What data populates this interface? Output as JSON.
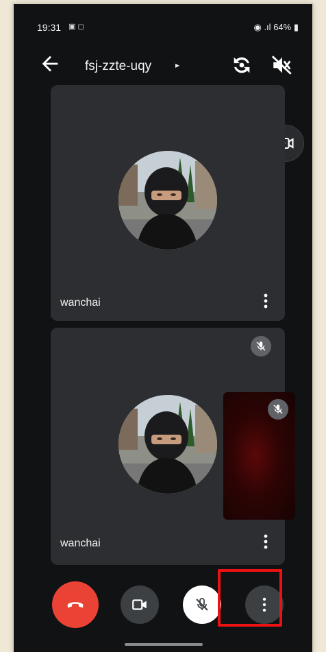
{
  "status_bar": {
    "time": "19:31",
    "left_icons": "▣ ◻",
    "right_text": "64%",
    "right_signal": "◉ .ıl"
  },
  "top_bar": {
    "meeting_code": "fsj-zzte-uqy",
    "caret": "▸",
    "icons": [
      "back-arrow-icon",
      "rotate-camera-icon",
      "speaker-off-icon"
    ]
  },
  "participants": [
    {
      "name": "wanchai",
      "muted": false
    },
    {
      "name": "wanchai",
      "muted": true
    }
  ],
  "self_view": {
    "muted": true,
    "background_color": "#5a0808"
  },
  "controls": {
    "items": [
      "end-call-icon",
      "camera-icon",
      "mic-off-icon",
      "more-vert-icon"
    ],
    "end_call_color": "#ea4335",
    "highlight_color": "#ee1111"
  }
}
